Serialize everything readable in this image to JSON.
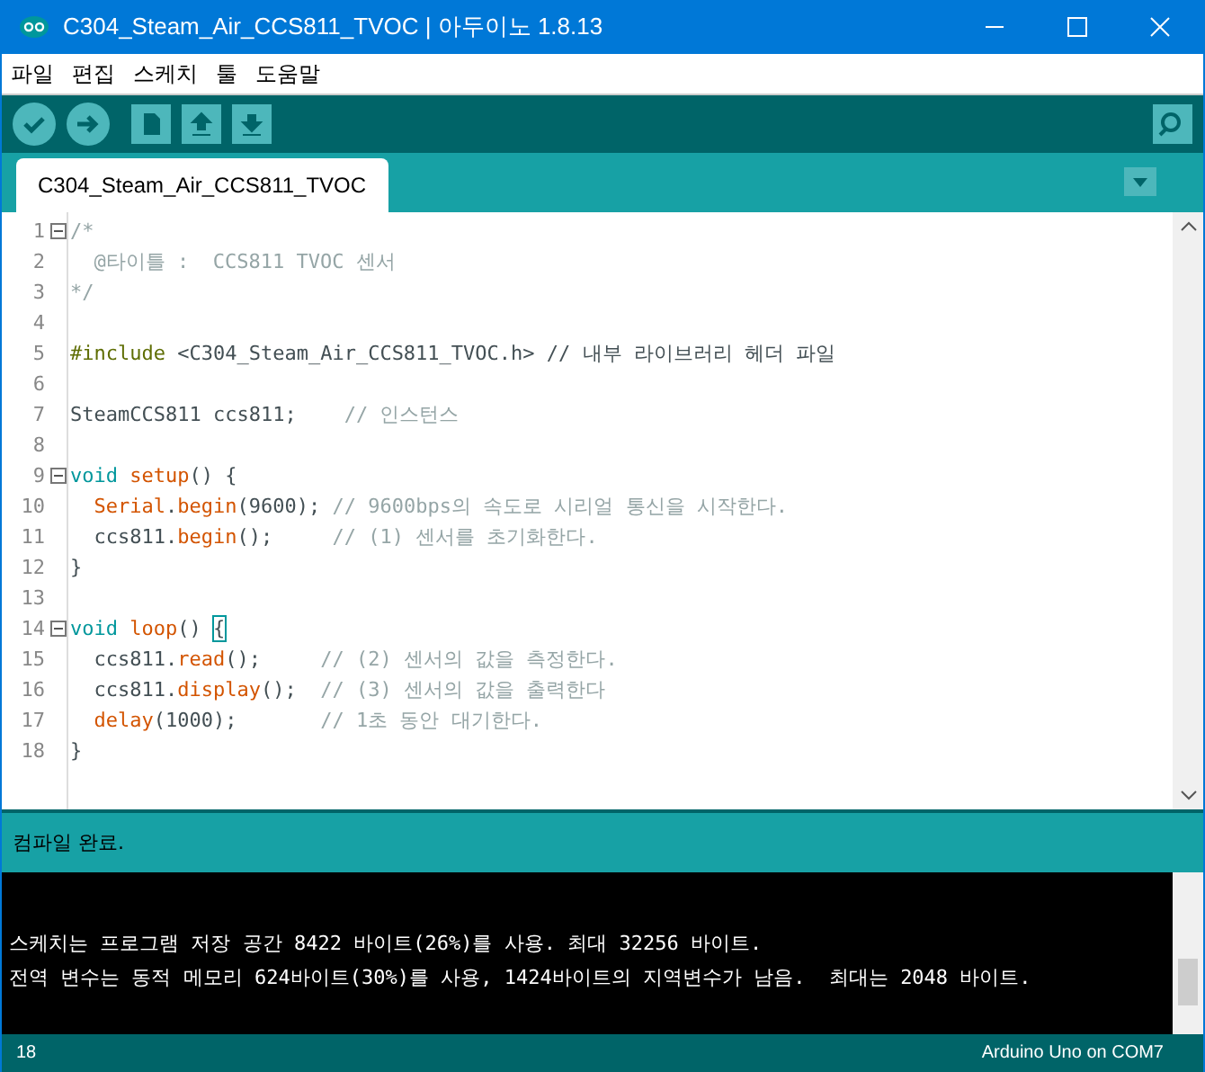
{
  "window": {
    "title": "C304_Steam_Air_CCS811_TVOC | 아두이노 1.8.13"
  },
  "menu": [
    "파일",
    "편집",
    "스케치",
    "툴",
    "도움말"
  ],
  "toolbar": [
    {
      "kind": "verify"
    },
    {
      "kind": "upload"
    },
    {
      "kind": "new"
    },
    {
      "kind": "open"
    },
    {
      "kind": "save"
    }
  ],
  "tabs": [
    {
      "label": "C304_Steam_Air_CCS811_TVOC",
      "selected": true
    }
  ],
  "editor": {
    "lines": [
      {
        "number": "1",
        "fold": true,
        "segments": [
          {
            "kind": "comment",
            "text": "/*"
          }
        ]
      },
      {
        "number": "2",
        "fold": false,
        "segments": [
          {
            "kind": "comment",
            "text": "  @타이틀 :  CCS811 TVOC 센서"
          }
        ]
      },
      {
        "number": "3",
        "fold": false,
        "segments": [
          {
            "kind": "comment",
            "text": "*/"
          }
        ]
      },
      {
        "number": "4",
        "fold": false
      },
      {
        "number": "5",
        "fold": false,
        "segments": [
          {
            "kind": "keyword",
            "text": "#include"
          },
          {
            "kind": "plain",
            "text": " <C304_Steam_Air_CCS811_TVOC.h> "
          },
          {
            "kind": "plain",
            "text": "// 내부 라이브러리 헤더 파일"
          }
        ]
      },
      {
        "number": "6",
        "fold": false
      },
      {
        "number": "7",
        "fold": false,
        "segments": [
          {
            "kind": "plain",
            "text": "SteamCCS811 ccs811;    "
          },
          {
            "kind": "comment",
            "text": "// 인스턴스"
          }
        ]
      },
      {
        "number": "8",
        "fold": false
      },
      {
        "number": "9",
        "fold": true,
        "segments": [
          {
            "kind": "type",
            "text": "void"
          },
          {
            "kind": "function",
            "text": " setup"
          },
          {
            "kind": "plain",
            "text": "() {"
          }
        ]
      },
      {
        "number": "10",
        "fold": false,
        "segments": [
          {
            "kind": "function",
            "text": "  Serial"
          },
          {
            "kind": "plain",
            "text": "."
          },
          {
            "kind": "function",
            "text": "begin"
          },
          {
            "kind": "plain",
            "text": "(9600); "
          },
          {
            "kind": "comment",
            "text": "// 9600bps의 속도로 시리얼 통신을 시작한다."
          }
        ]
      },
      {
        "number": "11",
        "fold": false,
        "segments": [
          {
            "kind": "plain",
            "text": "  ccs811."
          },
          {
            "kind": "function",
            "text": "begin"
          },
          {
            "kind": "plain",
            "text": "();     "
          },
          {
            "kind": "comment",
            "text": "// (1) 센서를 초기화한다."
          }
        ]
      },
      {
        "number": "12",
        "fold": false,
        "segments": [
          {
            "kind": "plain",
            "text": "}"
          }
        ]
      },
      {
        "number": "13",
        "fold": false
      },
      {
        "number": "14",
        "fold": true,
        "segments": [
          {
            "kind": "type",
            "text": "void"
          },
          {
            "kind": "function",
            "text": " loop"
          },
          {
            "kind": "plain",
            "text": "() "
          },
          {
            "kind": "bracket",
            "text": "{"
          }
        ]
      },
      {
        "number": "15",
        "fold": false,
        "segments": [
          {
            "kind": "plain",
            "text": "  ccs811."
          },
          {
            "kind": "function",
            "text": "read"
          },
          {
            "kind": "plain",
            "text": "();     "
          },
          {
            "kind": "comment",
            "text": "// (2) 센서의 값을 측정한다."
          }
        ]
      },
      {
        "number": "16",
        "fold": false,
        "segments": [
          {
            "kind": "plain",
            "text": "  ccs811."
          },
          {
            "kind": "function",
            "text": "display"
          },
          {
            "kind": "plain",
            "text": "();  "
          },
          {
            "kind": "comment",
            "text": "// (3) 센서의 값을 출력한다"
          }
        ]
      },
      {
        "number": "17",
        "fold": false,
        "segments": [
          {
            "kind": "function",
            "text": "  delay"
          },
          {
            "kind": "plain",
            "text": "(1000);       "
          },
          {
            "kind": "comment",
            "text": "// 1초 동안 대기한다."
          }
        ]
      },
      {
        "number": "18",
        "fold": false,
        "segments": [
          {
            "kind": "plain",
            "text": "}"
          }
        ]
      }
    ]
  },
  "message": "컴파일 완료.",
  "console": [
    "스케치는 프로그램 저장 공간 8422 바이트(26%)를 사용. 최대 32256 바이트.",
    "전역 변수는 동적 메모리 624바이트(30%)를 사용, 1424바이트의 지역변수가 남음.  최대는 2048 바이트."
  ],
  "status_bar": {
    "line": "18",
    "board": "Arduino Uno on COM7"
  }
}
